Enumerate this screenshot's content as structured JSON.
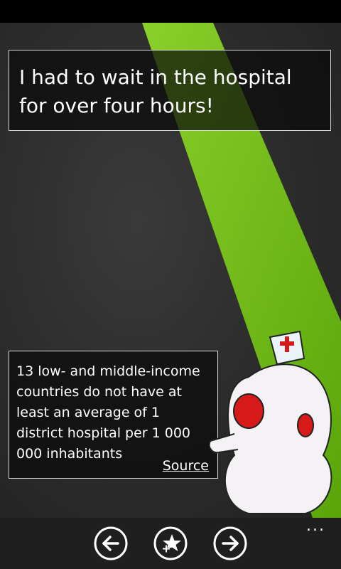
{
  "quote": {
    "text": "I had to wait in the hospital for over four hours!"
  },
  "fact": {
    "text": "13 low- and middle-income countries do not have at least an average of 1 district hospital per 1 000 000 inhabitants",
    "source_label": "Source"
  },
  "app_bar": {
    "buttons": [
      {
        "icon": "arrow-left-icon"
      },
      {
        "icon": "star-plus-icon"
      },
      {
        "icon": "arrow-right-icon"
      }
    ],
    "more_label": "..."
  },
  "colors": {
    "accent_green": "#6cb80f",
    "background": "#2e2e2e",
    "box_border": "#d8d8d8",
    "mascot_red": "#d61a1a"
  }
}
